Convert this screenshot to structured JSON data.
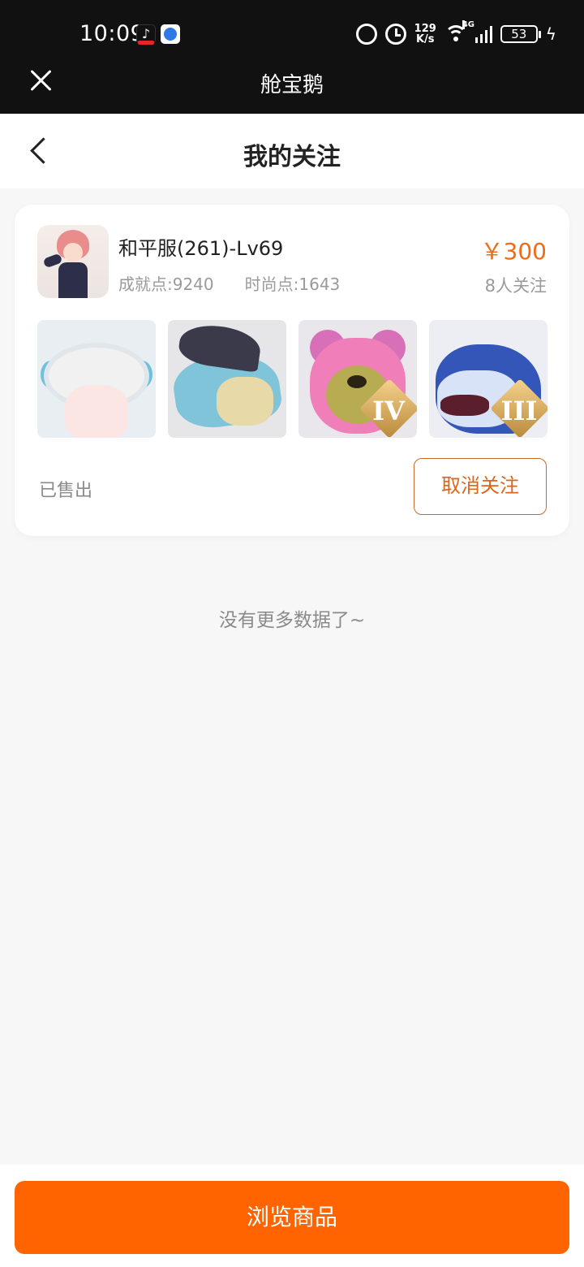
{
  "status_bar": {
    "time": "10:09",
    "net_speed_value": "129",
    "net_speed_unit": "K/s",
    "network": "4G",
    "battery": "53"
  },
  "miniapp": {
    "title": "舱宝鹅"
  },
  "page": {
    "title": "我的关注"
  },
  "card": {
    "title": "和平服(261)-Lv69",
    "achievement": "成就点:9240",
    "fashion": "时尚点:1643",
    "price": "￥300",
    "followers": "8人关注",
    "thumb_badges": [
      "",
      "",
      "IV",
      "III"
    ],
    "status": "已售出",
    "unfollow_label": "取消关注"
  },
  "list_end_text": "没有更多数据了~",
  "bottom": {
    "browse_label": "浏览商品"
  },
  "colors": {
    "accent": "#ff6400",
    "price": "#ef6c15",
    "topbar": "#111111"
  }
}
